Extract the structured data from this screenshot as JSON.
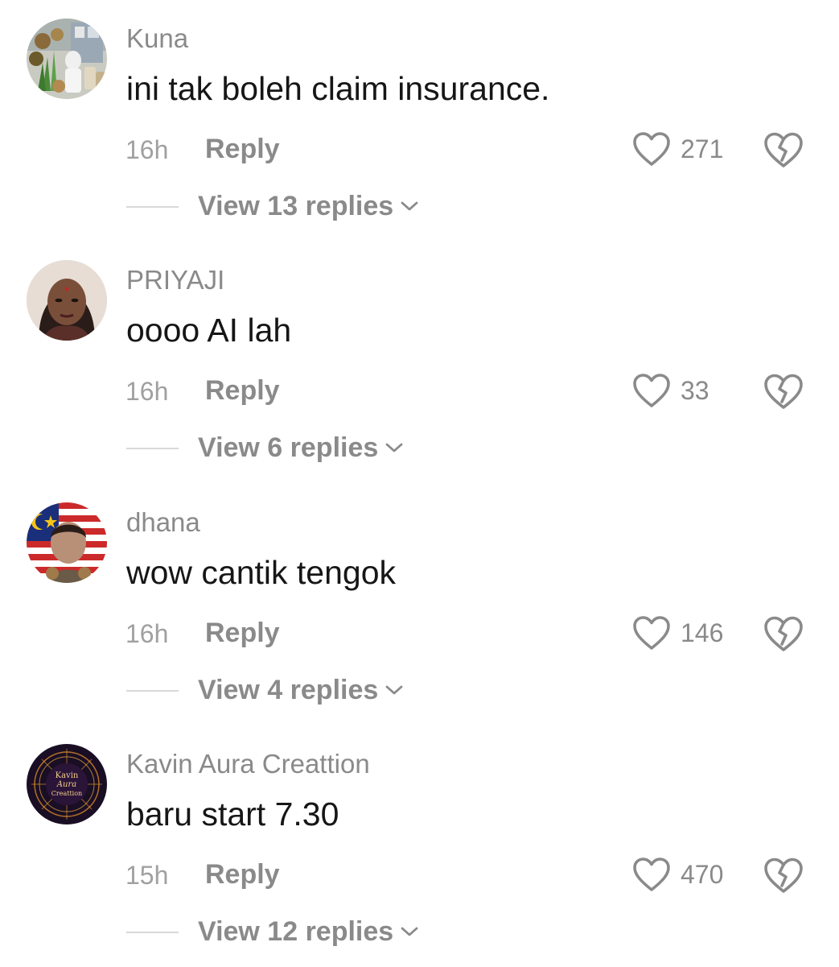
{
  "comments": [
    {
      "username": "Kuna",
      "text": "ini tak boleh claim insurance.",
      "time": "16h",
      "reply_label": "Reply",
      "likes": "271",
      "view_replies": "View 13 replies",
      "avatar_icon": "herbal-products-avatar"
    },
    {
      "username": "PRIYAJI",
      "text": "oooo AI lah",
      "time": "16h",
      "reply_label": "Reply",
      "likes": "33",
      "view_replies": "View 6 replies",
      "avatar_icon": "woman-portrait-avatar"
    },
    {
      "username": "dhana",
      "text": "wow cantik tengok",
      "time": "16h",
      "reply_label": "Reply",
      "likes": "146",
      "view_replies": "View 4 replies",
      "avatar_icon": "flag-portrait-avatar"
    },
    {
      "username": "Kavin Aura Creattion",
      "text": "baru start 7.30",
      "time": "15h",
      "reply_label": "Reply",
      "likes": "470",
      "view_replies": "View 12 replies",
      "avatar_icon": "kavin-aura-logo-avatar",
      "avatar_logo_text": [
        "Kavin",
        "Aura",
        "Creattion"
      ]
    }
  ],
  "colors": {
    "text": "#161616",
    "secondary": "#8a8a8a",
    "divider": "#d9d9d9"
  }
}
